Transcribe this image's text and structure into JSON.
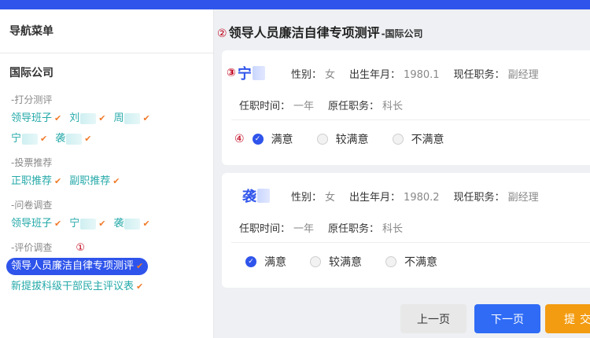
{
  "sidebar": {
    "title": "导航菜单",
    "org": "国际公司",
    "groups": [
      {
        "title": "-打分测评",
        "rows": [
          [
            "领导班子",
            "刘",
            "周"
          ],
          [
            "宁",
            "袭"
          ]
        ]
      },
      {
        "title": "-投票推荐",
        "rows": [
          [
            "正职推荐",
            "副职推荐"
          ]
        ]
      },
      {
        "title": "-问卷调查",
        "rows": [
          [
            "领导班子",
            "宁",
            "袭"
          ]
        ]
      },
      {
        "title": "-评价调查",
        "marker": "①",
        "rows": [
          [
            "领导人员廉洁自律专项测评"
          ],
          [
            "新提拔科级干部民主评议表"
          ]
        ]
      }
    ]
  },
  "main": {
    "marker": "②",
    "title": "领导人员廉洁自律专项测评",
    "subtitle": "-国际公司",
    "cards": [
      {
        "marker": "③",
        "name": "宁",
        "gender_label": "性别：",
        "gender": "女",
        "birth_label": "出生年月：",
        "birth": "1980.1",
        "post_label": "现任职务：",
        "post": "副经理",
        "tenure_label": "任职时间：",
        "tenure": "一年",
        "orig_label": "原任职务：",
        "orig": "科长",
        "rating_marker": "④",
        "options": [
          "满意",
          "较满意",
          "不满意"
        ],
        "selected": "满意"
      },
      {
        "name": "袭",
        "gender_label": "性别：",
        "gender": "女",
        "birth_label": "出生年月：",
        "birth": "1980.2",
        "post_label": "现任职务：",
        "post": "副经理",
        "tenure_label": "任职时间：",
        "tenure": "一年",
        "orig_label": "原任职务：",
        "orig": "科长",
        "options": [
          "满意",
          "较满意",
          "不满意"
        ],
        "selected": "满意"
      }
    ],
    "buttons": {
      "prev": "上一页",
      "next": "下一页",
      "submit": "提交"
    }
  }
}
